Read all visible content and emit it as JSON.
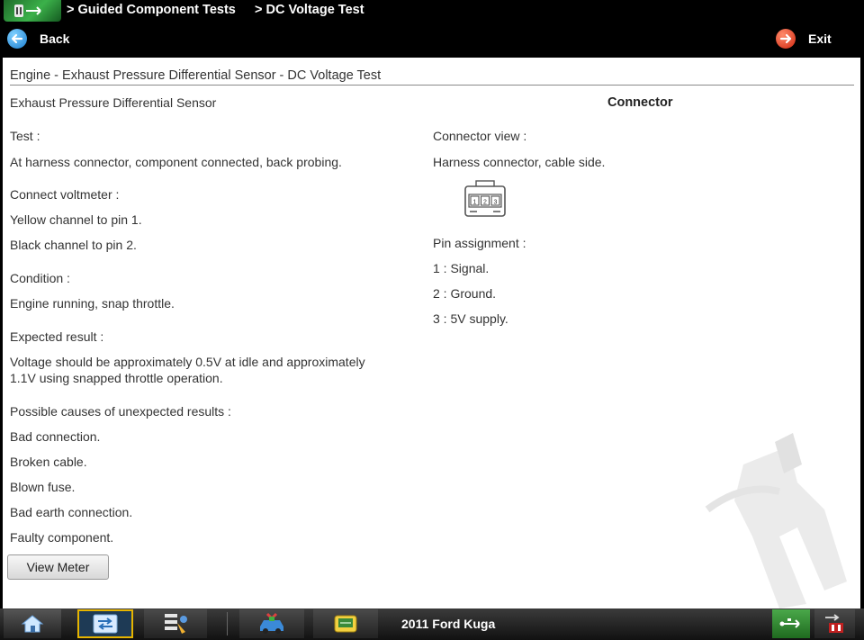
{
  "header": {
    "breadcrumbs": [
      "> Guided Component Tests",
      "> DC Voltage Test"
    ],
    "back_label": "Back",
    "exit_label": "Exit"
  },
  "content": {
    "title": "Engine - Exhaust Pressure Differential Sensor - DC Voltage Test",
    "component": "Exhaust Pressure Differential Sensor",
    "connector_heading": "Connector",
    "left": {
      "test_label": "Test :",
      "test_value": "At harness connector, component connected, back probing.",
      "connect_label": "Connect voltmeter :",
      "connect_line1": "Yellow channel to pin 1.",
      "connect_line2": "Black channel to pin 2.",
      "condition_label": "Condition :",
      "condition_value": "Engine running, snap throttle.",
      "expected_label": "Expected result :",
      "expected_line1": "Voltage should be approximately 0.5V at idle and approximately",
      "expected_line2": "1.1V using snapped throttle operation.",
      "causes_label": "Possible causes of unexpected results :",
      "causes": [
        "Bad connection.",
        "Broken cable.",
        "Blown fuse.",
        "Bad earth connection.",
        "Faulty component."
      ]
    },
    "right": {
      "connector_view_label": "Connector view :",
      "connector_view_value": "Harness connector, cable side.",
      "connector_pins": [
        "1",
        "2",
        "3"
      ],
      "pin_assignment_label": "Pin assignment :",
      "pins": [
        "1 : Signal.",
        "2 : Ground.",
        "3 : 5V supply."
      ]
    },
    "view_meter_label": "View Meter"
  },
  "taskbar": {
    "vehicle": "2011 Ford Kuga",
    "icons": [
      "home-icon",
      "component-tests-icon",
      "data-list-icon",
      "vehicle-tools-icon",
      "scanner-icon",
      "usb-icon",
      "power-icon"
    ]
  },
  "colors": {
    "header_bg": "#000000",
    "active_border": "#e6b400",
    "back_blue": "#1c7fd0",
    "exit_red": "#d02810"
  }
}
